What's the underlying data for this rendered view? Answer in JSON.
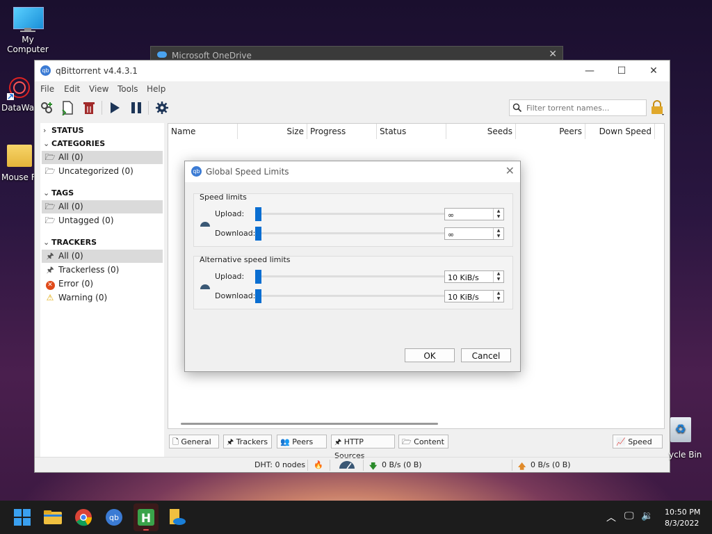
{
  "desktop": {
    "icons": [
      {
        "label": "My Computer"
      },
      {
        "label": "DataWag"
      },
      {
        "label": "Mouse Fi"
      },
      {
        "label": "ycle Bin"
      }
    ]
  },
  "background_window": {
    "title": "Microsoft OneDrive"
  },
  "window": {
    "title": "qBittorrent v4.4.3.1",
    "menu": [
      "File",
      "Edit",
      "View",
      "Tools",
      "Help"
    ],
    "search_placeholder": "Filter torrent names..."
  },
  "sidebar": {
    "status_header": "STATUS",
    "categories_header": "CATEGORIES",
    "categories": [
      "All (0)",
      "Uncategorized (0)"
    ],
    "tags_header": "TAGS",
    "tags": [
      "All (0)",
      "Untagged (0)"
    ],
    "trackers_header": "TRACKERS",
    "trackers": [
      "All (0)",
      "Trackerless (0)",
      "Error (0)",
      "Warning (0)"
    ]
  },
  "table": {
    "columns": [
      "Name",
      "Size",
      "Progress",
      "Status",
      "Seeds",
      "Peers",
      "Down Speed"
    ]
  },
  "bottom_tabs": [
    "General",
    "Trackers",
    "Peers",
    "HTTP Sources",
    "Content",
    "Speed"
  ],
  "statusbar": {
    "dht": "DHT: 0 nodes",
    "down": "0 B/s (0 B)",
    "up": "0 B/s (0 B)"
  },
  "dialog": {
    "title": "Global Speed Limits",
    "speed_group": "Speed limits",
    "alt_group": "Alternative speed limits",
    "upload_label": "Upload:",
    "download_label": "Download:",
    "upload_value": "∞",
    "download_value": "∞",
    "alt_upload_value": "10 KiB/s",
    "alt_download_value": "10 KiB/s",
    "ok": "OK",
    "cancel": "Cancel"
  },
  "taskbar": {
    "time": "10:50 PM",
    "date": "8/3/2022"
  },
  "colors": {
    "accent": "#0a6ed1",
    "qbit": "#3b7bd4"
  }
}
